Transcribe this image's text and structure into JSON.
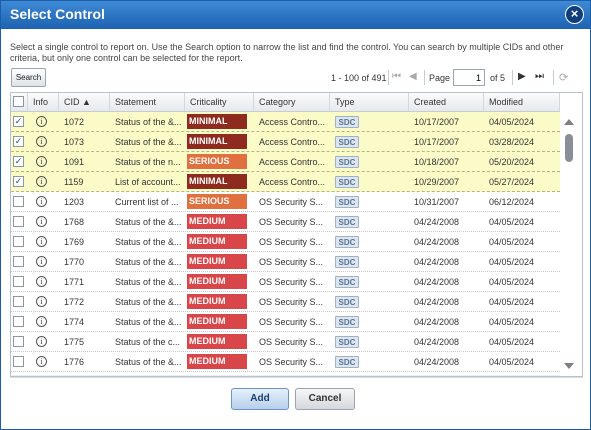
{
  "dialog": {
    "title": "Select Control",
    "close_label": "×",
    "instructions": "Select a single control to report on. Use the Search option to narrow the list and find the control. You can search by multiple CIDs and other criteria, but only one control can be selected for the report."
  },
  "toolbar": {
    "search_label": "Search",
    "range": "1 - 100 of 491",
    "page_label": "Page",
    "page_value": "1",
    "of_pages": "of 5",
    "first_icon": "first-page-icon",
    "prev_icon": "prev-page-icon",
    "next_icon": "next-page-icon",
    "last_icon": "last-page-icon",
    "refresh_icon": "refresh-icon"
  },
  "table": {
    "columns": [
      {
        "label": ""
      },
      {
        "label": "Info"
      },
      {
        "label": "CID ▲"
      },
      {
        "label": "Statement"
      },
      {
        "label": "Criticality"
      },
      {
        "label": "Category"
      },
      {
        "label": "Type"
      },
      {
        "label": "Created"
      },
      {
        "label": "Modified"
      }
    ],
    "rows": [
      {
        "checked": true,
        "check": "✓",
        "info": "i",
        "cid": "1072",
        "statement": "Status of the &...",
        "criticality": "MINIMAL",
        "crit_color": "#8f2a1e",
        "category": "Access Contro...",
        "type": "SDC",
        "created": "10/17/2007",
        "modified": "04/05/2024"
      },
      {
        "checked": true,
        "check": "✓",
        "info": "i",
        "cid": "1073",
        "statement": "Status of the &...",
        "criticality": "MINIMAL",
        "crit_color": "#8f2a1e",
        "category": "Access Contro...",
        "type": "SDC",
        "created": "10/17/2007",
        "modified": "03/28/2024"
      },
      {
        "checked": true,
        "check": "✓",
        "info": "i",
        "cid": "1091",
        "statement": "Status of the n...",
        "criticality": "SERIOUS",
        "crit_color": "#e07040",
        "category": "Access Contro...",
        "type": "SDC",
        "created": "10/18/2007",
        "modified": "05/20/2024"
      },
      {
        "checked": true,
        "check": "✓",
        "info": "i",
        "cid": "1159",
        "statement": "List of account...",
        "criticality": "MINIMAL",
        "crit_color": "#8f2a1e",
        "category": "Access Contro...",
        "type": "SDC",
        "created": "10/29/2007",
        "modified": "05/27/2024"
      },
      {
        "checked": false,
        "check": "",
        "info": "i",
        "cid": "1203",
        "statement": "Current list of ...",
        "criticality": "SERIOUS",
        "crit_color": "#e07040",
        "category": "OS Security S...",
        "type": "SDC",
        "created": "10/31/2007",
        "modified": "06/12/2024"
      },
      {
        "checked": false,
        "check": "",
        "info": "i",
        "cid": "1768",
        "statement": "Status of the &...",
        "criticality": "MEDIUM",
        "crit_color": "#d9464a",
        "category": "OS Security S...",
        "type": "SDC",
        "created": "04/24/2008",
        "modified": "04/05/2024"
      },
      {
        "checked": false,
        "check": "",
        "info": "i",
        "cid": "1769",
        "statement": "Status of the &...",
        "criticality": "MEDIUM",
        "crit_color": "#d9464a",
        "category": "OS Security S...",
        "type": "SDC",
        "created": "04/24/2008",
        "modified": "04/05/2024"
      },
      {
        "checked": false,
        "check": "",
        "info": "i",
        "cid": "1770",
        "statement": "Status of the &...",
        "criticality": "MEDIUM",
        "crit_color": "#d9464a",
        "category": "OS Security S...",
        "type": "SDC",
        "created": "04/24/2008",
        "modified": "04/05/2024"
      },
      {
        "checked": false,
        "check": "",
        "info": "i",
        "cid": "1771",
        "statement": "Status of the &...",
        "criticality": "MEDIUM",
        "crit_color": "#d9464a",
        "category": "OS Security S...",
        "type": "SDC",
        "created": "04/24/2008",
        "modified": "04/05/2024"
      },
      {
        "checked": false,
        "check": "",
        "info": "i",
        "cid": "1772",
        "statement": "Status of the &...",
        "criticality": "MEDIUM",
        "crit_color": "#d9464a",
        "category": "OS Security S...",
        "type": "SDC",
        "created": "04/24/2008",
        "modified": "04/05/2024"
      },
      {
        "checked": false,
        "check": "",
        "info": "i",
        "cid": "1774",
        "statement": "Status of the &...",
        "criticality": "MEDIUM",
        "crit_color": "#d9464a",
        "category": "OS Security S...",
        "type": "SDC",
        "created": "04/24/2008",
        "modified": "04/05/2024"
      },
      {
        "checked": false,
        "check": "",
        "info": "i",
        "cid": "1775",
        "statement": "Status of the c...",
        "criticality": "MEDIUM",
        "crit_color": "#d9464a",
        "category": "OS Security S...",
        "type": "SDC",
        "created": "04/24/2008",
        "modified": "04/05/2024"
      },
      {
        "checked": false,
        "check": "",
        "info": "i",
        "cid": "1776",
        "statement": "Status of the &...",
        "criticality": "MEDIUM",
        "crit_color": "#d9464a",
        "category": "OS Security S...",
        "type": "SDC",
        "created": "04/24/2008",
        "modified": "04/05/2024"
      }
    ]
  },
  "buttons": {
    "add_label": "Add",
    "cancel_label": "Cancel"
  }
}
